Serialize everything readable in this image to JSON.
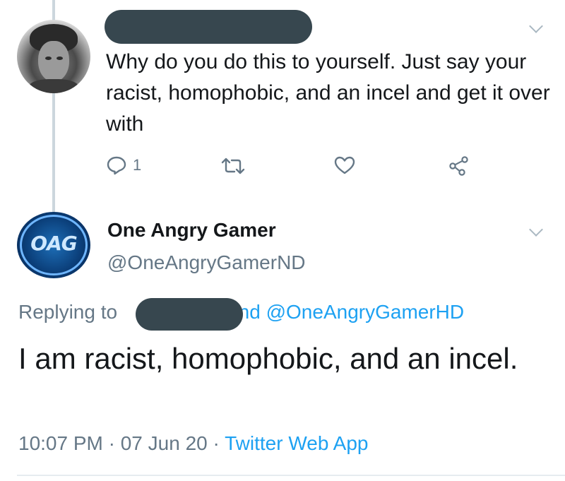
{
  "reply_tweet": {
    "text": "Why do you do this to yourself. Just say your racist, homophobic, and an incel and get it over with",
    "reply_count": "1"
  },
  "main_tweet": {
    "display_name": "One Angry Gamer",
    "handle": "@OneAngryGamerND",
    "avatar_text": "OAG",
    "replying_label": "Replying to",
    "replying_and": "and",
    "replying_mention": "@OneAngryGamerHD",
    "text": "I am racist, homophobic, and an incel.",
    "timestamp": "10:07 PM · 07 Jun 20 · ",
    "source": "Twitter Web App"
  },
  "colors": {
    "link": "#1da1f2",
    "muted": "#657786",
    "redaction": "#37474f"
  }
}
